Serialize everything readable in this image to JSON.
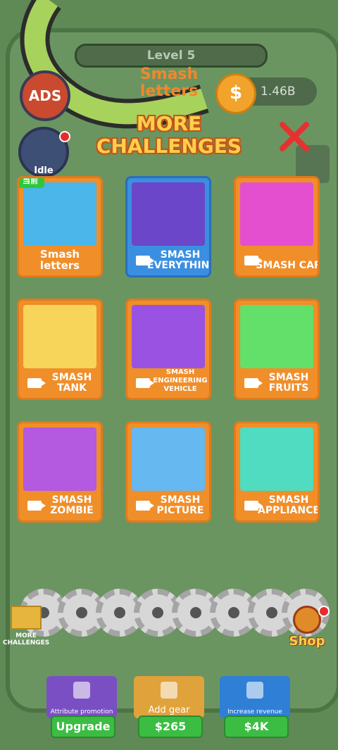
{
  "header": {
    "level": "Level 5",
    "ads_label": "ADS",
    "idle_label": "Idle",
    "mode_title": "Smash letters",
    "coin_symbol": "$",
    "coins": "1.46B"
  },
  "dialog": {
    "title": "MORE CHALLENGES",
    "current_badge": "当前",
    "cards": [
      {
        "label": "Smash letters",
        "video": false,
        "selected": false,
        "current": true,
        "bg": "#4ab6ea"
      },
      {
        "label": "SMASH EVERYTHING",
        "video": true,
        "selected": true,
        "current": false,
        "bg": "#6b46c9"
      },
      {
        "label": "SMASH CAR",
        "video": true,
        "selected": false,
        "current": false,
        "bg": "#e44fd0"
      },
      {
        "label": "SMASH TANK",
        "video": true,
        "selected": false,
        "current": false,
        "bg": "#f6d55a"
      },
      {
        "label": "SMASH ENGINEERING VEHICLE",
        "video": true,
        "selected": false,
        "current": false,
        "bg": "#9a52e2"
      },
      {
        "label": "SMASH FRUITS",
        "video": true,
        "selected": false,
        "current": false,
        "bg": "#62e06a"
      },
      {
        "label": "SMASH ZOMBIE",
        "video": true,
        "selected": false,
        "current": false,
        "bg": "#b35ae0"
      },
      {
        "label": "SMASH PICTURE",
        "video": true,
        "selected": false,
        "current": false,
        "bg": "#65b8f0"
      },
      {
        "label": "SMASH APPLIANCE",
        "video": true,
        "selected": false,
        "current": false,
        "bg": "#4fdcc0"
      }
    ]
  },
  "side": {
    "more_challenges": "MORE CHALLENGES",
    "shop": "Shop"
  },
  "upgrades": [
    {
      "title": "Attribute promotion",
      "button": "Upgrade",
      "color": "#7b4fc4"
    },
    {
      "title": "Add gear",
      "button": "$265",
      "color": "#e0a23a"
    },
    {
      "title": "Increase revenue",
      "button": "$4K",
      "color": "#2f7fd6"
    }
  ]
}
